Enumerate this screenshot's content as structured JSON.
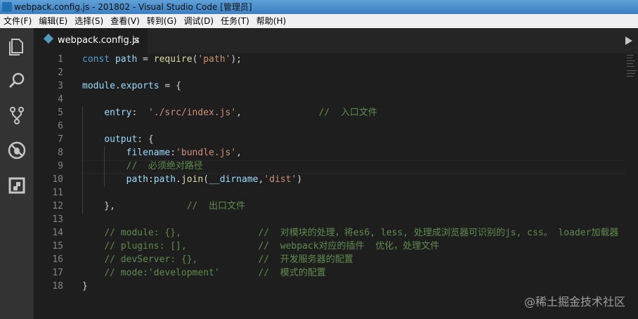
{
  "window": {
    "title": "webpack.config.js - 201802 - Visual Studio Code [管理员]"
  },
  "menu": [
    "文件(F)",
    "编辑(E)",
    "选择(S)",
    "查看(V)",
    "转到(G)",
    "调试(D)",
    "任务(T)",
    "帮助(H)"
  ],
  "activity_bar": {
    "icons": [
      "files-icon",
      "search-icon",
      "source-control-icon",
      "debug-icon",
      "extensions-icon"
    ]
  },
  "tab": {
    "label": "webpack.config.js",
    "close": "×"
  },
  "colors": {
    "keyword": "#569cd6",
    "string": "#ce9178",
    "comment": "#608b4e",
    "function": "#dcdcaa",
    "variable": "#9cdcfe"
  },
  "lines": [
    {
      "n": "1",
      "tokens": [
        [
          "kw",
          "const"
        ],
        [
          "pl",
          " "
        ],
        [
          "var",
          "path"
        ],
        [
          "pl",
          " = "
        ],
        [
          "fn",
          "require"
        ],
        [
          "pl",
          "("
        ],
        [
          "str",
          "'path'"
        ],
        [
          "pl",
          ");"
        ]
      ]
    },
    {
      "n": "2",
      "tokens": []
    },
    {
      "n": "3",
      "tokens": [
        [
          "var",
          "module"
        ],
        [
          "pl",
          "."
        ],
        [
          "var",
          "exports"
        ],
        [
          "pl",
          " = {"
        ]
      ]
    },
    {
      "n": "4",
      "tokens": []
    },
    {
      "n": "5",
      "tokens": [
        [
          "pl",
          "    "
        ],
        [
          "var",
          "entry"
        ],
        [
          "pl",
          ":  "
        ],
        [
          "str",
          "'./src/index.js'"
        ],
        [
          "pl",
          ",              "
        ],
        [
          "cm",
          "//  入口文件"
        ]
      ]
    },
    {
      "n": "6",
      "tokens": []
    },
    {
      "n": "7",
      "tokens": [
        [
          "pl",
          "    "
        ],
        [
          "var",
          "output"
        ],
        [
          "pl",
          ": {"
        ]
      ]
    },
    {
      "n": "8",
      "tokens": [
        [
          "pl",
          "        "
        ],
        [
          "var",
          "filename"
        ],
        [
          "pl",
          ":"
        ],
        [
          "str",
          "'bundle.js'"
        ],
        [
          "pl",
          ","
        ]
      ]
    },
    {
      "n": "9",
      "tokens": [
        [
          "pl",
          "        "
        ],
        [
          "cm",
          "//  必须绝对路径"
        ]
      ]
    },
    {
      "n": "10",
      "tokens": [
        [
          "pl",
          "        "
        ],
        [
          "var",
          "path"
        ],
        [
          "pl",
          ":"
        ],
        [
          "var",
          "path"
        ],
        [
          "pl",
          "."
        ],
        [
          "fn",
          "join"
        ],
        [
          "pl",
          "("
        ],
        [
          "var",
          "__dirname"
        ],
        [
          "pl",
          ","
        ],
        [
          "str",
          "'dist'"
        ],
        [
          "pl",
          ")"
        ]
      ]
    },
    {
      "n": "11",
      "tokens": []
    },
    {
      "n": "12",
      "tokens": [
        [
          "pl",
          "    },             "
        ],
        [
          "cm",
          "//  出口文件"
        ]
      ]
    },
    {
      "n": "13",
      "tokens": []
    },
    {
      "n": "14",
      "tokens": [
        [
          "pl",
          "    "
        ],
        [
          "cm",
          "// module: {},              //  对模块的处理，将es6, less, 处理成浏览器可识别的js, css。 loader加载器"
        ]
      ]
    },
    {
      "n": "15",
      "tokens": [
        [
          "pl",
          "    "
        ],
        [
          "cm",
          "// plugins: [],             //  webpack对应的插件  优化，处理文件"
        ]
      ]
    },
    {
      "n": "16",
      "tokens": [
        [
          "pl",
          "    "
        ],
        [
          "cm",
          "// devServer: {},           //  开发服务器的配置"
        ]
      ]
    },
    {
      "n": "17",
      "tokens": [
        [
          "pl",
          "    "
        ],
        [
          "cm",
          "// mode:'development'       //  模式的配置"
        ]
      ]
    },
    {
      "n": "18",
      "tokens": [
        [
          "pl",
          "}"
        ]
      ]
    }
  ],
  "watermark": "@稀土掘金技术社区"
}
